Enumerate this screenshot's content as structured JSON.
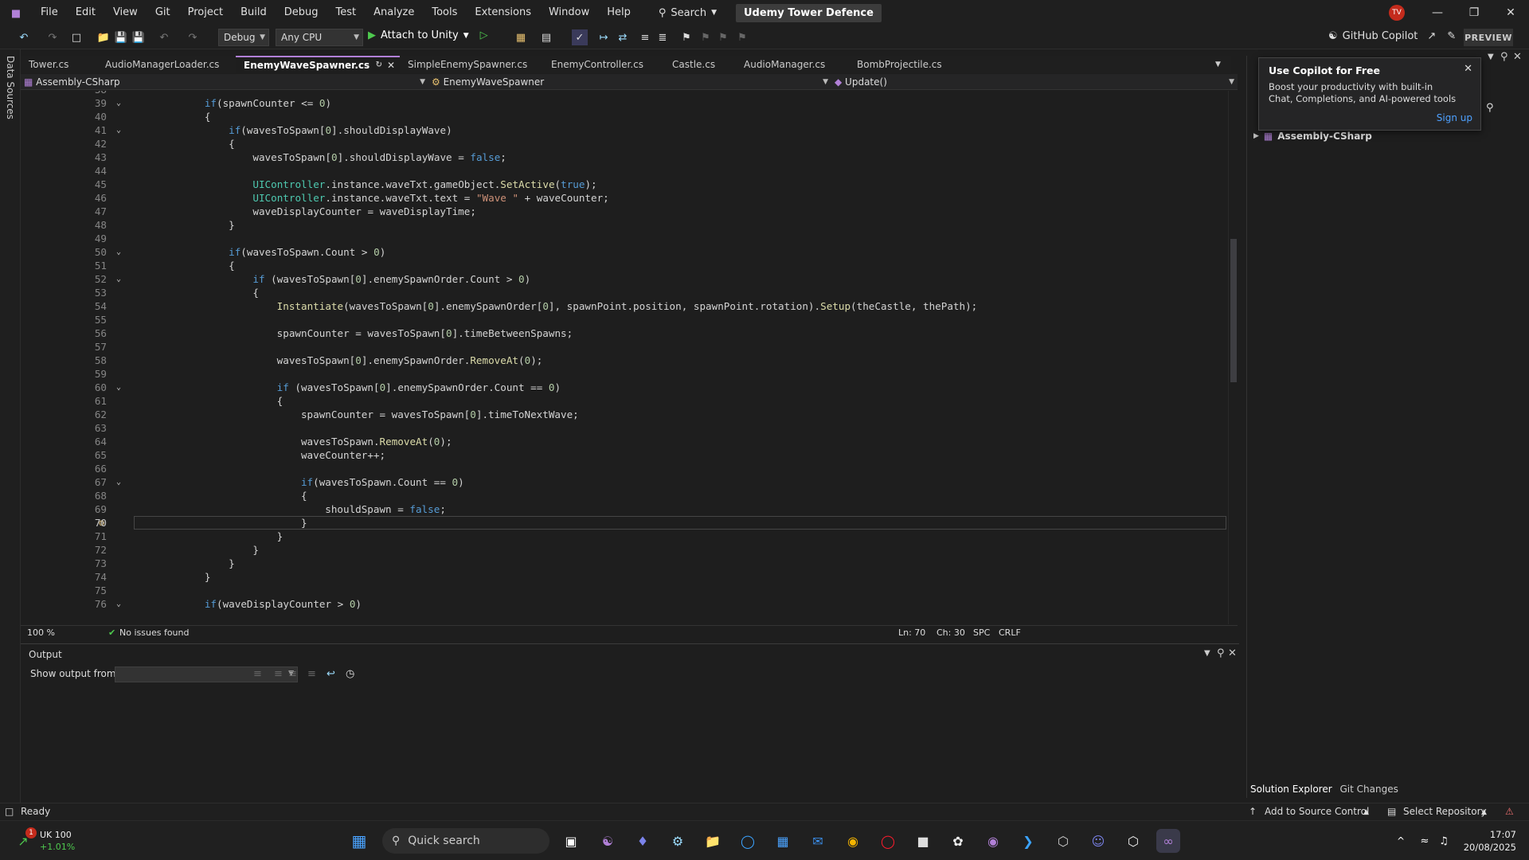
{
  "menubar": {
    "items": [
      "File",
      "Edit",
      "View",
      "Git",
      "Project",
      "Build",
      "Debug",
      "Test",
      "Analyze",
      "Tools",
      "Extensions",
      "Window",
      "Help"
    ],
    "search_label": "Search",
    "solution_title": "Udemy Tower Defence",
    "avatar_initials": "TV"
  },
  "toolbar": {
    "config": "Debug",
    "platform": "Any CPU",
    "attach_label": "Attach to Unity",
    "copilot_label": "GitHub Copilot",
    "preview_label": "PREVIEW"
  },
  "leftstrip": {
    "label": "Data Sources"
  },
  "tabs": [
    {
      "label": "Tower.cs",
      "active": false
    },
    {
      "label": "AudioManagerLoader.cs",
      "active": false
    },
    {
      "label": "EnemyWaveSpawner.cs",
      "active": true
    },
    {
      "label": "SimpleEnemySpawner.cs",
      "active": false
    },
    {
      "label": "EnemyController.cs",
      "active": false
    },
    {
      "label": "Castle.cs",
      "active": false
    },
    {
      "label": "AudioManager.cs",
      "active": false
    },
    {
      "label": "BombProjectile.cs",
      "active": false
    }
  ],
  "navbar": {
    "project": "Assembly-CSharp",
    "class": "EnemyWaveSpawner",
    "member": "Update()"
  },
  "editor": {
    "current_line": 70,
    "lines": [
      {
        "n": "38",
        "t": ""
      },
      {
        "n": "39",
        "t": "if(spawnCounter <= 0)"
      },
      {
        "n": "40",
        "t": "{"
      },
      {
        "n": "41",
        "t": "if(wavesToSpawn[0].shouldDisplayWave)"
      },
      {
        "n": "42",
        "t": "{"
      },
      {
        "n": "43",
        "t": "wavesToSpawn[0].shouldDisplayWave = false;"
      },
      {
        "n": "44",
        "t": ""
      },
      {
        "n": "45",
        "t": "UIController.instance.waveTxt.gameObject.SetActive(true);"
      },
      {
        "n": "46",
        "t": "UIController.instance.waveTxt.text = \"Wave \" + waveCounter;"
      },
      {
        "n": "47",
        "t": "waveDisplayCounter = waveDisplayTime;"
      },
      {
        "n": "48",
        "t": "}"
      },
      {
        "n": "49",
        "t": ""
      },
      {
        "n": "50",
        "t": "if(wavesToSpawn.Count > 0)"
      },
      {
        "n": "51",
        "t": "{"
      },
      {
        "n": "52",
        "t": "if (wavesToSpawn[0].enemySpawnOrder.Count > 0)"
      },
      {
        "n": "53",
        "t": "{"
      },
      {
        "n": "54",
        "t": "Instantiate(wavesToSpawn[0].enemySpawnOrder[0], spawnPoint.position, spawnPoint.rotation).Setup(theCastle, thePath);"
      },
      {
        "n": "55",
        "t": ""
      },
      {
        "n": "56",
        "t": "spawnCounter = wavesToSpawn[0].timeBetweenSpawns;"
      },
      {
        "n": "57",
        "t": ""
      },
      {
        "n": "58",
        "t": "wavesToSpawn[0].enemySpawnOrder.RemoveAt(0);"
      },
      {
        "n": "59",
        "t": ""
      },
      {
        "n": "60",
        "t": "if (wavesToSpawn[0].enemySpawnOrder.Count == 0)"
      },
      {
        "n": "61",
        "t": "{"
      },
      {
        "n": "62",
        "t": "spawnCounter = wavesToSpawn[0].timeToNextWave;"
      },
      {
        "n": "63",
        "t": ""
      },
      {
        "n": "64",
        "t": "wavesToSpawn.RemoveAt(0);"
      },
      {
        "n": "65",
        "t": "waveCounter++;"
      },
      {
        "n": "66",
        "t": ""
      },
      {
        "n": "67",
        "t": "if(wavesToSpawn.Count == 0)"
      },
      {
        "n": "68",
        "t": "{"
      },
      {
        "n": "69",
        "t": "shouldSpawn = false;"
      },
      {
        "n": "70",
        "t": "}"
      },
      {
        "n": "71",
        "t": "}"
      },
      {
        "n": "72",
        "t": "}"
      },
      {
        "n": "73",
        "t": "}"
      },
      {
        "n": "74",
        "t": "}"
      },
      {
        "n": "75",
        "t": ""
      },
      {
        "n": "76",
        "t": "if(waveDisplayCounter > 0)"
      }
    ]
  },
  "editor_status": {
    "zoom": "100 %",
    "issues": "No issues found",
    "ln": "Ln: 70",
    "ch": "Ch: 30",
    "spc": "SPC",
    "crlf": "CRLF"
  },
  "output": {
    "title": "Output",
    "show_from_label": "Show output from:",
    "show_from_value": ""
  },
  "copilot_popup": {
    "title": "Use Copilot for Free",
    "body": "Boost your productivity with built-in Chat, Completions, and AI-powered tools",
    "signup": "Sign up"
  },
  "solution_explorer": {
    "root": "Assembly-CSharp",
    "tab1": "Solution Explorer",
    "tab2": "Git Changes"
  },
  "statusbar": {
    "ready": "Ready",
    "source_control": "Add to Source Control",
    "repository": "Select Repository"
  },
  "taskbar": {
    "stock_name": "UK 100",
    "stock_change": "+1.01%",
    "badge": "1",
    "search_placeholder": "Quick search",
    "time": "17:07",
    "date": "20/08/2025"
  },
  "colors": {
    "accent": "#b180d7",
    "keyword": "#569cd6",
    "type": "#4ec9b0",
    "method": "#dcdcaa",
    "number": "#b5cea8",
    "string": "#ce9178"
  }
}
